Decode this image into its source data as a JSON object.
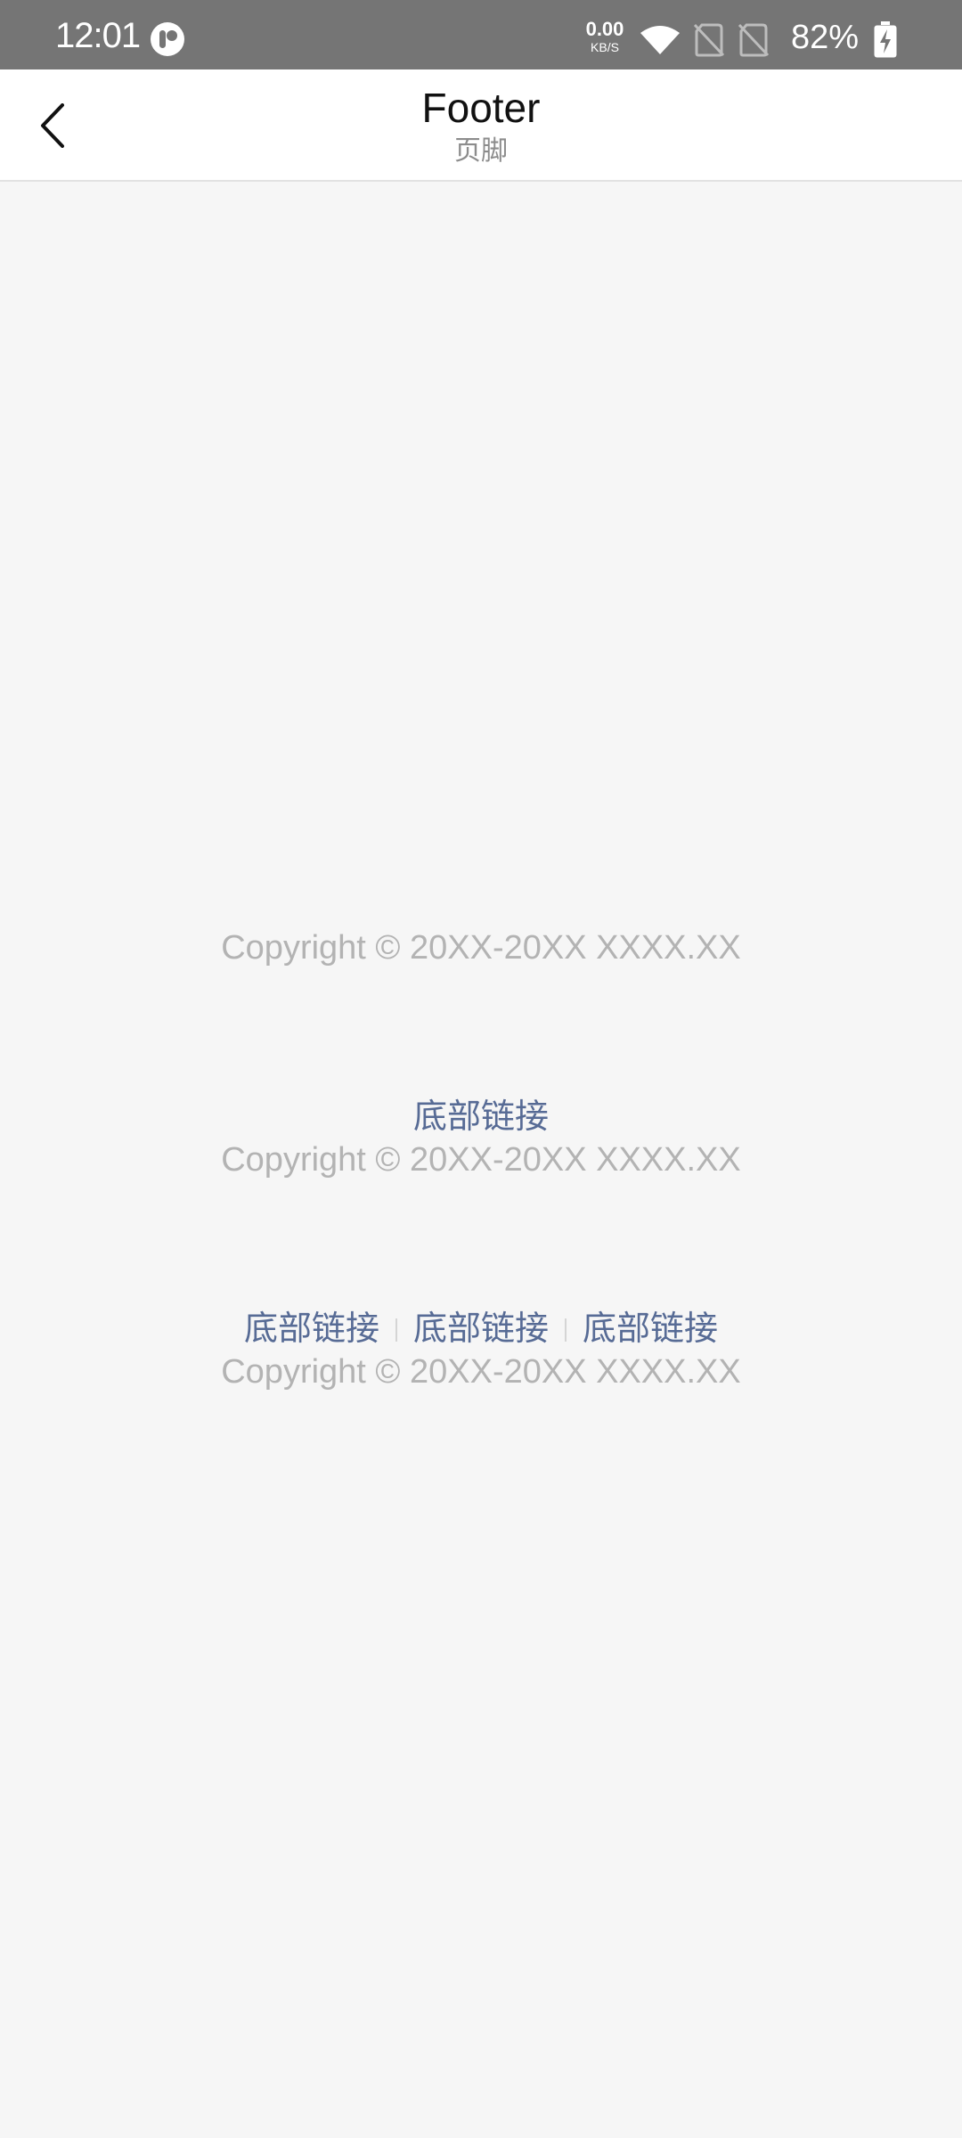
{
  "status_bar": {
    "time": "12:01",
    "net_speed_value": "0.00",
    "net_speed_unit": "KB/S",
    "battery_percent": "82%",
    "icons": [
      "app-notification-icon",
      "wifi-icon",
      "no-sim-icon",
      "no-sim-icon",
      "battery-charging-icon"
    ],
    "background_color": "#757575"
  },
  "nav": {
    "title": "Footer",
    "subtitle": "页脚",
    "back_icon": "chevron-left-icon"
  },
  "footers": [
    {
      "copyright": "Copyright © 20XX-20XX XXXX.XX"
    },
    {
      "links": [
        "底部链接"
      ],
      "copyright": "Copyright © 20XX-20XX XXXX.XX"
    },
    {
      "links": [
        "底部链接",
        "底部链接",
        "底部链接"
      ],
      "copyright": "Copyright © 20XX-20XX XXXX.XX"
    }
  ],
  "colors": {
    "page_background": "#f6f6f6",
    "link": "#576b95",
    "copyright_text": "#b3b3b3"
  }
}
